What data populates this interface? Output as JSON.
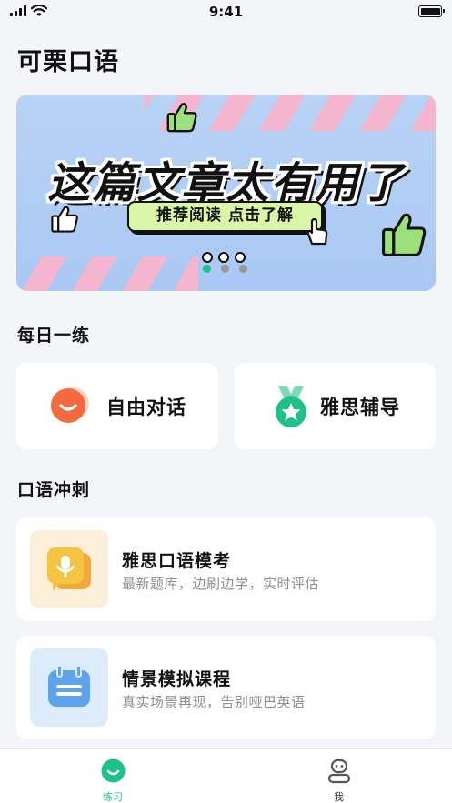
{
  "status": {
    "time": "9:41"
  },
  "page": {
    "title": "可栗口语"
  },
  "banner": {
    "headline": "这篇文章太有用了",
    "cta": "推荐阅读 点击了解"
  },
  "daily": {
    "title": "每日一练",
    "items": [
      {
        "label": "自由对话",
        "icon": "chat-bubble-icon"
      },
      {
        "label": "雅思辅导",
        "icon": "star-medal-icon"
      }
    ]
  },
  "sprint": {
    "title": "口语冲刺",
    "courses": [
      {
        "title": "雅思口语模考",
        "subtitle": "最新题库，边刷边学，实时评估",
        "icon": "microphone-chat-icon"
      },
      {
        "title": "情景模拟课程",
        "subtitle": "真实场景再现，告别哑巴英语",
        "icon": "calendar-icon"
      }
    ]
  },
  "tabs": [
    {
      "label": "练习",
      "icon": "practice-icon",
      "active": true
    },
    {
      "label": "我",
      "icon": "profile-icon",
      "active": false
    }
  ],
  "colors": {
    "accent": "#1fc08a",
    "orange": "#f26a3d",
    "yellow": "#f6c443",
    "cta_green": "#d9f7a6",
    "stripe_pink": "#f4b6cf"
  }
}
